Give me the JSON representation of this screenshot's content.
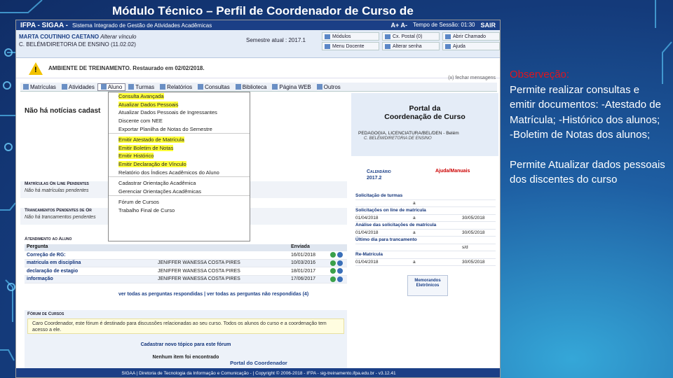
{
  "slide": {
    "title": "Módulo Técnico – Perfil de Coordenador de Curso de"
  },
  "app": {
    "brand": "IFPA - SIGAA -",
    "system": "Sistema Integrado de Gestão de Atividades Acadêmicas",
    "font_controls": "A+ A-",
    "session": "Tempo de Sessão: 01:30",
    "logout": "SAIR"
  },
  "user": {
    "name": "MARTA COUTINHO CAETANO",
    "change": "Alterar vínculo",
    "unit": "C. BELÉM/DIRETORIA DE ENSINO (11.02.02)",
    "semester": "Semestre atual : 2017.1"
  },
  "quick": [
    "Módulos",
    "Cx. Postal (0)",
    "Abrir Chamado",
    "Menu Docente",
    "Alterar senha",
    "Ajuda"
  ],
  "warning": {
    "text": "AMBIENTE DE TREINAMENTO. Restaurado em 02/02/2018.",
    "close": "(x) fechar mensagens"
  },
  "menu": [
    "Matrículas",
    "Atividades",
    "Aluno",
    "Turmas",
    "Relatórios",
    "Consultas",
    "Biblioteca",
    "Página WEB",
    "Outros"
  ],
  "dropdown": [
    {
      "label": "Consulta Avançada",
      "hl": true,
      "sep": false
    },
    {
      "label": "Atualizar Dados Pessoais",
      "hl": true,
      "sep": false
    },
    {
      "label": "Atualizar Dados Pessoais de Ingressantes",
      "hl": false,
      "sep": false
    },
    {
      "label": "Discente com NEE",
      "hl": false,
      "sep": false
    },
    {
      "label": "Exportar Planilha de Notas do Semestre",
      "hl": false,
      "sep": false
    },
    {
      "label": "",
      "hl": false,
      "sep": true
    },
    {
      "label": "Emitir Atestado de Matrícula",
      "hl": true,
      "sep": false
    },
    {
      "label": "Emitir Boletim de Notas",
      "hl": true,
      "sep": false
    },
    {
      "label": "Emitir Histórico",
      "hl": true,
      "sep": false
    },
    {
      "label": "Emitir Declaração de Vínculo",
      "hl": true,
      "sep": false
    },
    {
      "label": "Relatório dos Índices Acadêmicos do Aluno",
      "hl": false,
      "sep": false
    },
    {
      "label": "",
      "hl": false,
      "sep": true
    },
    {
      "label": "Cadastrar Orientação Acadêmica",
      "hl": false,
      "sep": false
    },
    {
      "label": "Gerenciar Orientações Acadêmicas",
      "hl": false,
      "sep": false
    },
    {
      "label": "",
      "hl": false,
      "sep": true
    },
    {
      "label": "Fórum de Cursos",
      "hl": false,
      "sep": false
    },
    {
      "label": "Trabalho Final de Curso",
      "hl": false,
      "sep": false
    }
  ],
  "left": {
    "news": "Não há notícias cadast",
    "sec1": "Matrículas On Line Pendentes",
    "none1": "Não há matrículas pendentes",
    "sec2": "Trancamentos Pendentes de Or",
    "none2": "Não há trancamentos pendentes",
    "sec3": "Atendimento ao Aluno"
  },
  "questions": {
    "headers": [
      "Pergunta",
      "",
      "Enviada",
      ""
    ],
    "rows": [
      {
        "q": "Correção de RG:",
        "who": "",
        "date": "16/01/2018"
      },
      {
        "q": "matricula em disciplina",
        "who": "JENIFFER WANESSA COSTA PIRES",
        "date": "10/03/2016"
      },
      {
        "q": "declaração de estagio",
        "who": "JENIFFER WANESSA COSTA PIRES",
        "date": "18/01/2017"
      },
      {
        "q": "informação",
        "who": "JENIFFER WANESSA COSTA PIRES",
        "date": "17/06/2017"
      }
    ],
    "links": "ver todas as perguntas respondidas  |  ver todas as perguntas não respondidas (4)"
  },
  "forum": {
    "title": "Fórum de Cursos",
    "text": "Caro Coordenador, este fórum é destinado para discussões relacionadas ao seu curso. Todos os alunos do curso e a coordenação tem acesso a ele.",
    "new": "Cadastrar novo tópico para este fórum",
    "none": "Nenhum item foi encontrado"
  },
  "portal": {
    "title1": "Portal da",
    "title2": "Coordenação de Curso",
    "course": "PEDAGOGIA, LICENCIATURA/BEL/DEN - Belém",
    "campus": "C. BELÉM/DIRETORIA DE ENSINO",
    "cal1": "Calendário",
    "cal2": "2017.2",
    "help": "Ajuda/Manuais"
  },
  "calendar": [
    {
      "h": true,
      "a": "Solicitação de turmas",
      "m": "",
      "d": ""
    },
    {
      "h": false,
      "a": "",
      "m": "a",
      "d": ""
    },
    {
      "h": true,
      "a": "Solicitações on line de matrícula",
      "m": "",
      "d": ""
    },
    {
      "h": false,
      "a": "01/04/2018",
      "m": "a",
      "d": "30/05/2018"
    },
    {
      "h": true,
      "a": "Análise das solicitações de matrícula",
      "m": "",
      "d": ""
    },
    {
      "h": false,
      "a": "01/04/2018",
      "m": "a",
      "d": "30/05/2018"
    },
    {
      "h": true,
      "a": "Último dia para trancamento",
      "m": "",
      "d": ""
    },
    {
      "h": false,
      "a": "",
      "m": "",
      "d": "s/d"
    },
    {
      "h": true,
      "a": "Re-Matrícula",
      "m": "",
      "d": ""
    },
    {
      "h": false,
      "a": "01/04/2018",
      "m": "a",
      "d": "30/05/2018"
    }
  ],
  "memo": {
    "l1": "Memorandos",
    "l2": "Eletrônicos"
  },
  "footer": {
    "portal": "Portal do Coordenador",
    "copy": "SIGAA | Diretoria de Tecnologia da Informação e Comunicação - | Copyright © 2006-2018 - IFPA - sig-treinamento.ifpa.edu.br - v3.12.41"
  },
  "note": {
    "obs": "Observeção:",
    "text1": "Permite realizar consultas e emitir documentos: -Atestado de Matrícula; -Histórico dos alunos; -Boletim de Notas dos alunos;",
    "text2": "Permite Atualizar dados pessoais dos discentes do curso"
  }
}
